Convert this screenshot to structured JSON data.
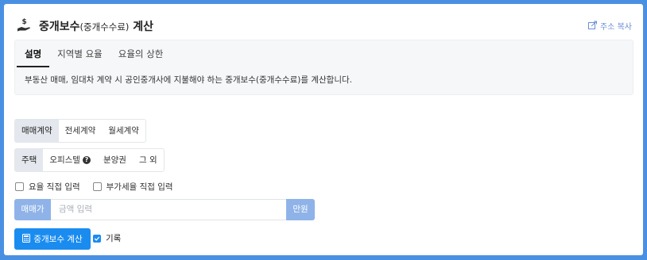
{
  "header": {
    "title_main": "중개보수",
    "title_sub": "(중개수수료)",
    "title_tail": " 계산",
    "share_label": "주소 복사"
  },
  "info": {
    "tabs": [
      {
        "label": "설명",
        "active": true
      },
      {
        "label": "지역별 요율",
        "active": false
      },
      {
        "label": "요율의 상한",
        "active": false
      }
    ],
    "description": "부동산 매매, 임대차 계약 시 공인중개사에 지불해야 하는 중개보수(중개수수료)를 계산합니다."
  },
  "contract_types": [
    {
      "label": "매매계약",
      "active": true
    },
    {
      "label": "전세계약",
      "active": false
    },
    {
      "label": "월세계약",
      "active": false
    }
  ],
  "property_types": [
    {
      "label": "주택",
      "active": true
    },
    {
      "label": "오피스텔",
      "active": false,
      "help_icon": "?"
    },
    {
      "label": "분양권",
      "active": false
    },
    {
      "label": "그 외",
      "active": false
    }
  ],
  "options": {
    "direct_rate": "요율 직접 입력",
    "direct_vat": "부가세율 직접 입력"
  },
  "amount": {
    "prefix": "매매가",
    "placeholder": "금액 입력",
    "suffix": "만원"
  },
  "actions": {
    "calculate_label": "중개보수 계산",
    "record_label": "기록",
    "record_checked": true
  },
  "colors": {
    "background": "#4a90e2",
    "primary": "#1a8cf0",
    "addon": "#8fb3e8"
  }
}
